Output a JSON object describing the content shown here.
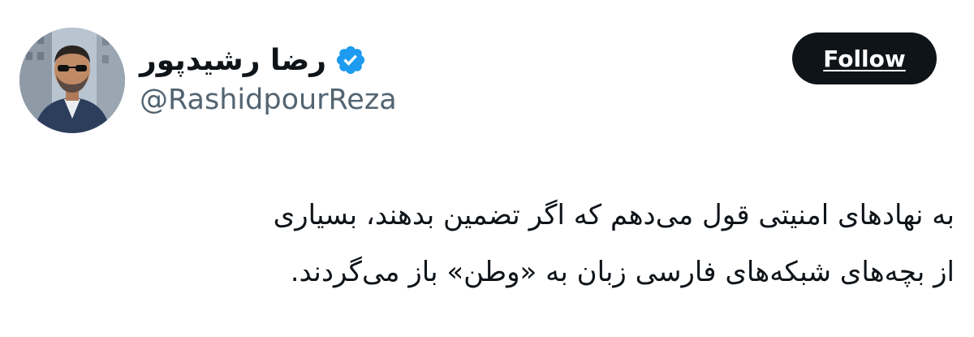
{
  "user": {
    "display_name": "رضا رشیدپور",
    "handle": "@RashidpourReza",
    "verified": true,
    "avatar_icon": "profile-photo"
  },
  "follow_button": {
    "label": "Follow",
    "background_color": "#0f1419",
    "text_color": "#ffffff"
  },
  "tweet": {
    "lines": [
      "به نهادهای امنیتی قول می‌دهم که اگر تضمین بدهند، بسیاری",
      "از بچه‌های شبکه‌های فارسی زبان به «وطن» باز می‌گردند."
    ]
  },
  "colors": {
    "verified_badge": "#1d9bf0",
    "handle_text": "#536471",
    "primary_text": "#0f1419"
  }
}
